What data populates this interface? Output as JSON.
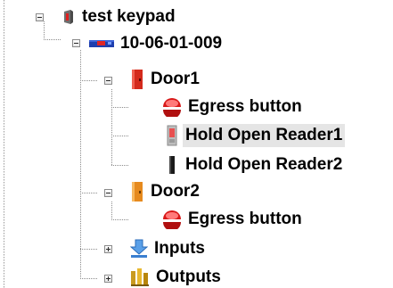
{
  "tree": {
    "root": {
      "label": "test keypad",
      "icon": "keypad-icon"
    },
    "controller": {
      "label": "10-06-01-009",
      "icon": "controller-icon"
    },
    "door1": {
      "label": "Door1",
      "icon": "door-icon",
      "color": "#d42a1c",
      "children": [
        {
          "label": "Egress button",
          "icon": "red-button-icon"
        },
        {
          "label": "Hold Open Reader1",
          "icon": "reader-light-icon",
          "selected": true
        },
        {
          "label": "Hold Open Reader2",
          "icon": "reader-dark-icon"
        }
      ]
    },
    "door2": {
      "label": "Door2",
      "icon": "door-icon",
      "color": "#e68a1e",
      "children": [
        {
          "label": "Egress button",
          "icon": "red-button-icon"
        }
      ]
    },
    "inputs": {
      "label": "Inputs",
      "icon": "arrow-down-icon",
      "collapsed": true
    },
    "outputs": {
      "label": "Outputs",
      "icon": "bars-icon",
      "collapsed": true
    }
  }
}
